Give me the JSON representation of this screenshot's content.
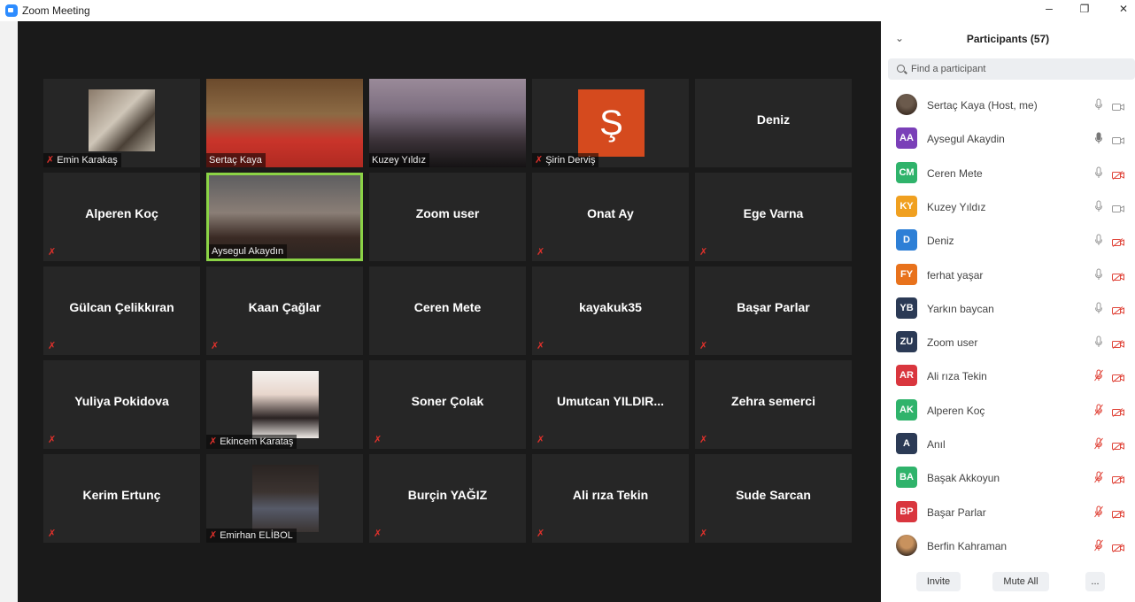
{
  "window": {
    "title": "Zoom Meeting",
    "minimize": "–",
    "restore": "❐",
    "close": "✕"
  },
  "grid": {
    "tiles": [
      {
        "name": "Emin Karakaş",
        "kind": "video",
        "muted": true
      },
      {
        "name": "Sertaç Kaya",
        "kind": "video",
        "muted": false
      },
      {
        "name": "Kuzey Yıldız",
        "kind": "video",
        "muted": false
      },
      {
        "name": "Şirin Derviş",
        "kind": "video",
        "muted": true,
        "badge": "Ş"
      },
      {
        "name": "Deniz",
        "kind": "name",
        "muted": false
      },
      {
        "name": "Alperen Koç",
        "kind": "name",
        "muted": true
      },
      {
        "name": "Aysegul Akaydın",
        "kind": "video",
        "muted": false,
        "active": true
      },
      {
        "name": "Zoom user",
        "kind": "name",
        "muted": false
      },
      {
        "name": "Onat Ay",
        "kind": "name",
        "muted": true
      },
      {
        "name": "Ege Varna",
        "kind": "name",
        "muted": true
      },
      {
        "name": "Gülcan Çelikkıran",
        "kind": "name",
        "muted": true
      },
      {
        "name": "Kaan Çağlar",
        "kind": "name",
        "muted": true
      },
      {
        "name": "Ceren Mete",
        "kind": "name",
        "muted": false
      },
      {
        "name": "kayakuk35",
        "kind": "name",
        "muted": true
      },
      {
        "name": "Başar Parlar",
        "kind": "name",
        "muted": true
      },
      {
        "name": "Yuliya Pokidova",
        "kind": "name",
        "muted": true
      },
      {
        "name": "Ekincem Karataş",
        "kind": "video",
        "muted": true
      },
      {
        "name": "Soner Çolak",
        "kind": "name",
        "muted": true
      },
      {
        "name": "Umutcan YILDIR...",
        "kind": "name",
        "muted": true
      },
      {
        "name": "Zehra semerci",
        "kind": "name",
        "muted": true
      },
      {
        "name": "Kerim Ertunç",
        "kind": "name",
        "muted": true
      },
      {
        "name": "Emirhan ELİBOL",
        "kind": "video",
        "muted": true
      },
      {
        "name": "Burçin YAĞIZ",
        "kind": "name",
        "muted": true
      },
      {
        "name": "Ali rıza Tekin",
        "kind": "name",
        "muted": true
      },
      {
        "name": "Sude Sarcan",
        "kind": "name",
        "muted": true
      }
    ]
  },
  "participants": {
    "title": "Participants (57)",
    "search_placeholder": "Find a participant",
    "list": [
      {
        "initials": "",
        "photo": true,
        "color": "#6b5a4c",
        "name": "Sertaç Kaya (Host, me)",
        "mic": "on",
        "cam": "on"
      },
      {
        "initials": "AA",
        "color": "#7a3fb8",
        "name": "Aysegul Akaydin",
        "mic": "talking",
        "cam": "on"
      },
      {
        "initials": "CM",
        "color": "#2fb36b",
        "name": "Ceren Mete",
        "mic": "on",
        "cam": "off"
      },
      {
        "initials": "KY",
        "color": "#f0a020",
        "name": "Kuzey Yıldız",
        "mic": "on",
        "cam": "on"
      },
      {
        "initials": "D",
        "color": "#2d7fd6",
        "name": "Deniz",
        "mic": "on",
        "cam": "off"
      },
      {
        "initials": "FY",
        "color": "#e8721c",
        "name": "ferhat yaşar",
        "mic": "on",
        "cam": "off"
      },
      {
        "initials": "YB",
        "color": "#2b3a55",
        "name": "Yarkın baycan",
        "mic": "on",
        "cam": "off"
      },
      {
        "initials": "ZU",
        "color": "#2b3a55",
        "name": "Zoom user",
        "mic": "on",
        "cam": "off"
      },
      {
        "initials": "AR",
        "color": "#d9363e",
        "name": "Ali rıza Tekin",
        "mic": "off",
        "cam": "off"
      },
      {
        "initials": "AK",
        "color": "#2fb36b",
        "name": "Alperen Koç",
        "mic": "off",
        "cam": "off"
      },
      {
        "initials": "A",
        "color": "#2b3a55",
        "name": "Anıl",
        "mic": "off",
        "cam": "off"
      },
      {
        "initials": "BA",
        "color": "#2fb36b",
        "name": "Başak Akkoyun",
        "mic": "off",
        "cam": "off"
      },
      {
        "initials": "BP",
        "color": "#d9363e",
        "name": "Başar Parlar",
        "mic": "off",
        "cam": "off"
      },
      {
        "initials": "",
        "photo": true,
        "color": "#c8925e",
        "name": "Berfin Kahraman",
        "mic": "off",
        "cam": "off"
      }
    ],
    "buttons": {
      "invite": "Invite",
      "mute_all": "Mute All",
      "more": "..."
    }
  }
}
